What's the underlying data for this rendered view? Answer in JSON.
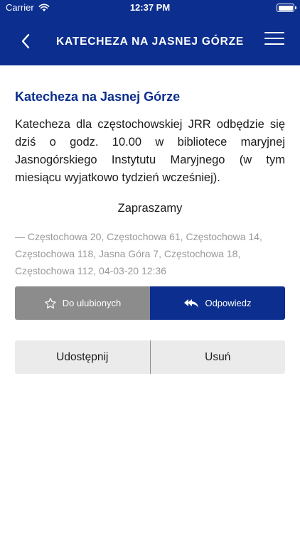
{
  "status_bar": {
    "carrier": "Carrier",
    "time": "12:37 PM"
  },
  "nav": {
    "title": "KATECHEZA NA JASNEJ GÓRZE",
    "back_icon": "chevron-left-icon",
    "menu_icon": "hamburger-menu-icon"
  },
  "article": {
    "title": "Katecheza na Jasnej Górze",
    "body": "Katecheza dla częstochowskiej JRR odbędzie się dziś o godz. 10.00 w bibliotece maryjnej Jasnogórskiego Instytutu Maryjnego (w tym miesiącu wyjatkowo tydzień wcześniej).",
    "closing": "Zapraszamy",
    "meta": "— Częstochowa 20, Częstochowa 61, Częstochowa 14, Częstochowa 118, Jasna Góra 7, Częstochowa 18, Częstochowa 112, 04-03-20 12:36"
  },
  "actions": {
    "favorite_label": "Do ulubionych",
    "reply_label": "Odpowiedz",
    "share_label": "Udostępnij",
    "delete_label": "Usuń"
  },
  "colors": {
    "brand": "#0b2e8f",
    "secondary_button": "#8c8c8c",
    "light_button": "#ebebeb",
    "meta_text": "#999999"
  }
}
